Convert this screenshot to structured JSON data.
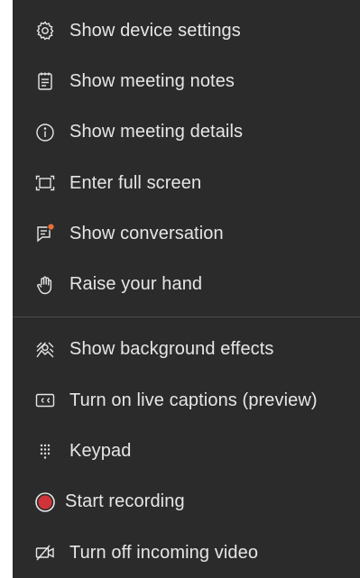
{
  "menu": {
    "items": [
      {
        "label": "Show device settings",
        "icon": "gear-icon"
      },
      {
        "label": "Show meeting notes",
        "icon": "notes-icon"
      },
      {
        "label": "Show meeting details",
        "icon": "info-icon"
      },
      {
        "label": "Enter full screen",
        "icon": "fullscreen-icon"
      },
      {
        "label": "Show conversation",
        "icon": "chat-icon"
      },
      {
        "label": "Raise your hand",
        "icon": "hand-icon"
      },
      {
        "label": "Show background effects",
        "icon": "background-effects-icon"
      },
      {
        "label": "Turn on live captions (preview)",
        "icon": "captions-icon"
      },
      {
        "label": "Keypad",
        "icon": "keypad-icon"
      },
      {
        "label": "Start recording",
        "icon": "record-icon"
      },
      {
        "label": "Turn off incoming video",
        "icon": "video-off-icon"
      }
    ],
    "colors": {
      "background": "#2b2b2b",
      "text": "#e6e6e6",
      "notification_dot": "#e8703a",
      "record": "#d13438"
    }
  }
}
